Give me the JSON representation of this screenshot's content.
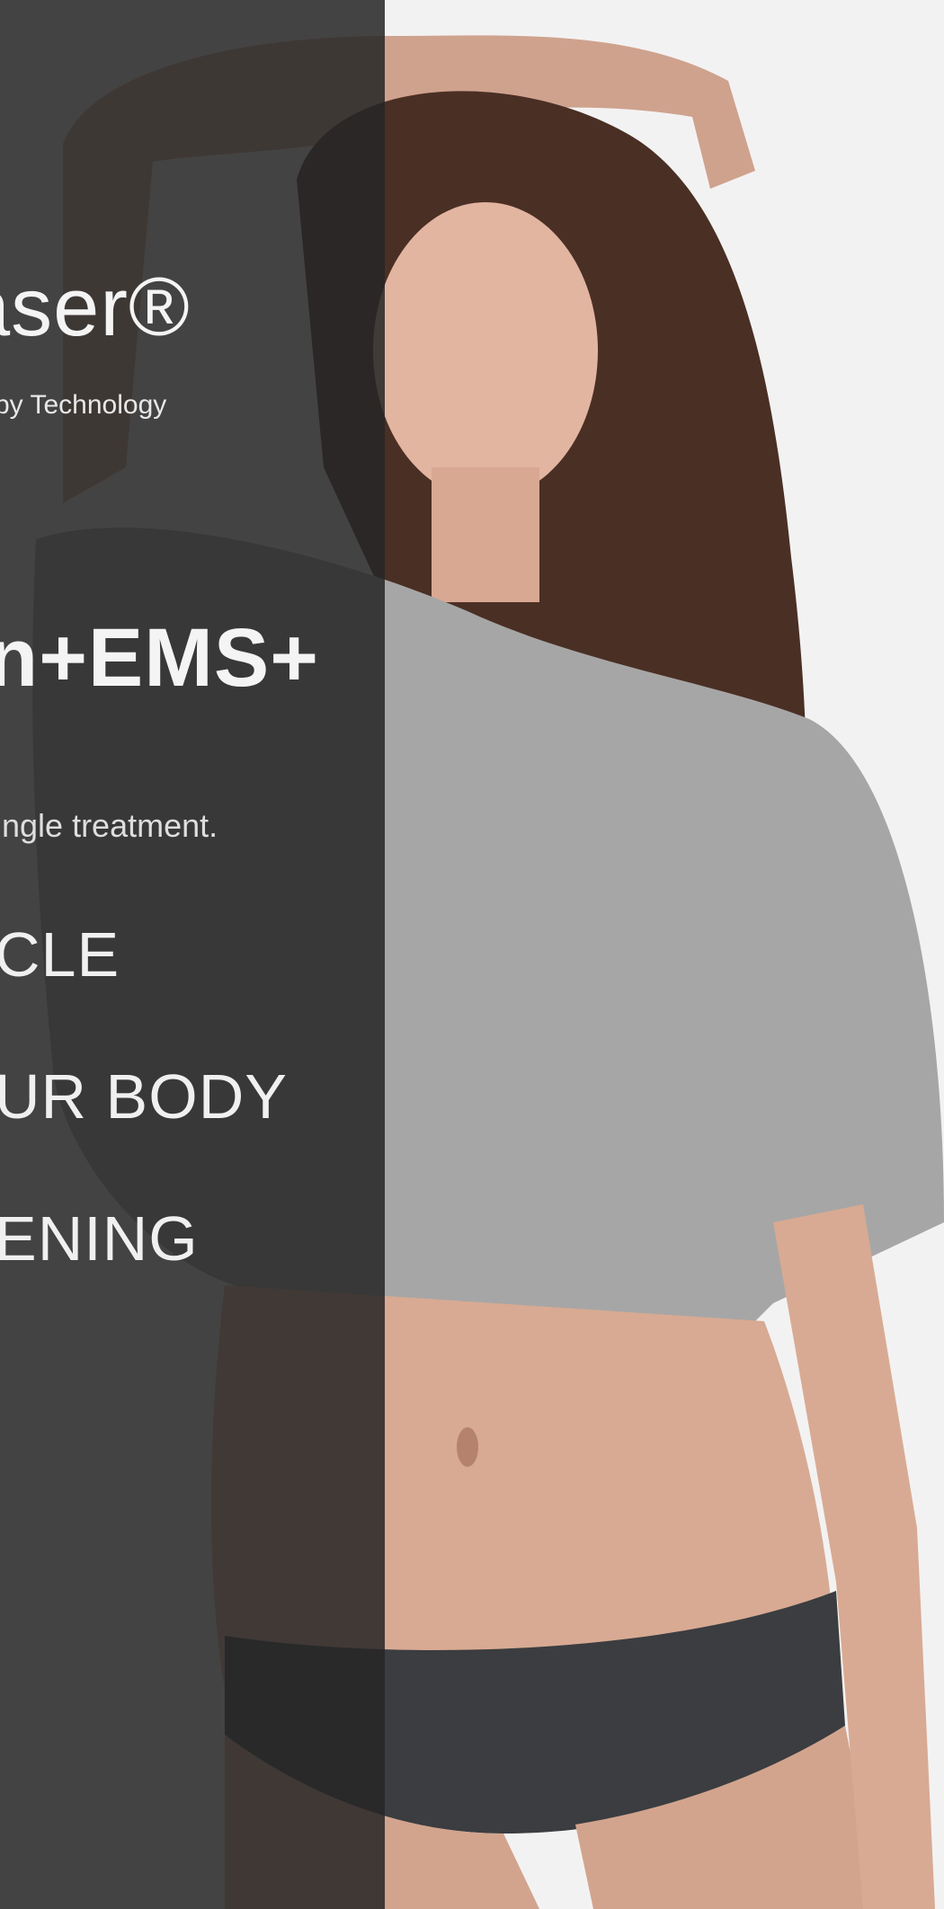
{
  "brand": {
    "name": "aser®"
  },
  "tagline": "py Technology",
  "headline": "n+EMS+",
  "description": "ingle treatment.",
  "features": [
    "CLE",
    "UR BODY",
    "ENING"
  ],
  "colors": {
    "overlay": "#262626",
    "background": "#f3f2f2",
    "text": "#f4f4f4"
  }
}
